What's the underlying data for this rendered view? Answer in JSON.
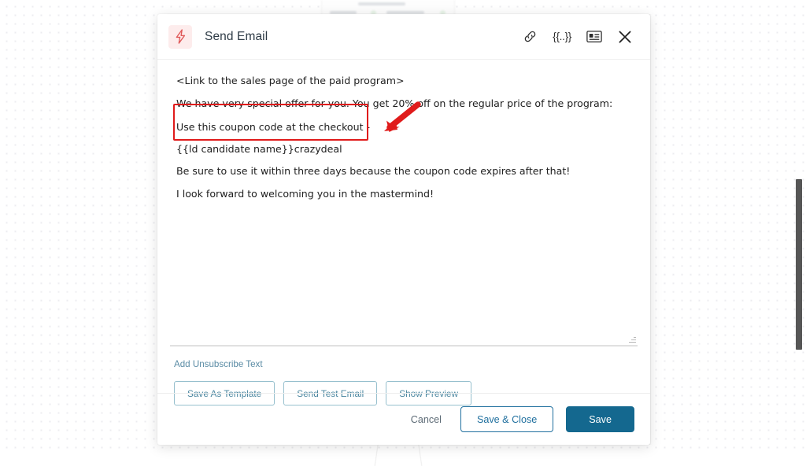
{
  "header": {
    "title": "Send Email",
    "app_icon": "lightning-bolt-icon",
    "icons": {
      "link": "link-icon",
      "merge_tag": "{{..}}",
      "template": "template-card-icon",
      "close": "close-icon"
    }
  },
  "editor": {
    "paragraphs": [
      "<Link to the sales page of the paid program>",
      "We have very special offer for you. You get 20% off on the regular price of the program:"
    ],
    "coupon_lines": [
      "Use this coupon code at the checkout -",
      "{{ld candidate name}}crazydeal"
    ],
    "closing_paragraphs": [
      "Be sure to use it within three days because the coupon code expires after that!",
      "I look forward to welcoming you in the mastermind!"
    ]
  },
  "actions": {
    "unsubscribe_link": "Add Unsubscribe Text",
    "save_as_template": "Save As Template",
    "send_test_email": "Send Test Email",
    "show_preview": "Show Preview"
  },
  "footer": {
    "cancel": "Cancel",
    "save_and_close": "Save & Close",
    "save": "Save"
  },
  "annotation": {
    "highlight_color": "#e01b1b",
    "arrow_color": "#e01b1b"
  },
  "colors": {
    "primary_button": "#14688f",
    "outline_button": "#1f6f9e",
    "teal_button": "#4c87a0",
    "link": "#5b8ca5",
    "app_icon_bg": "#fdecec",
    "app_icon_fg": "#e05a5a"
  }
}
